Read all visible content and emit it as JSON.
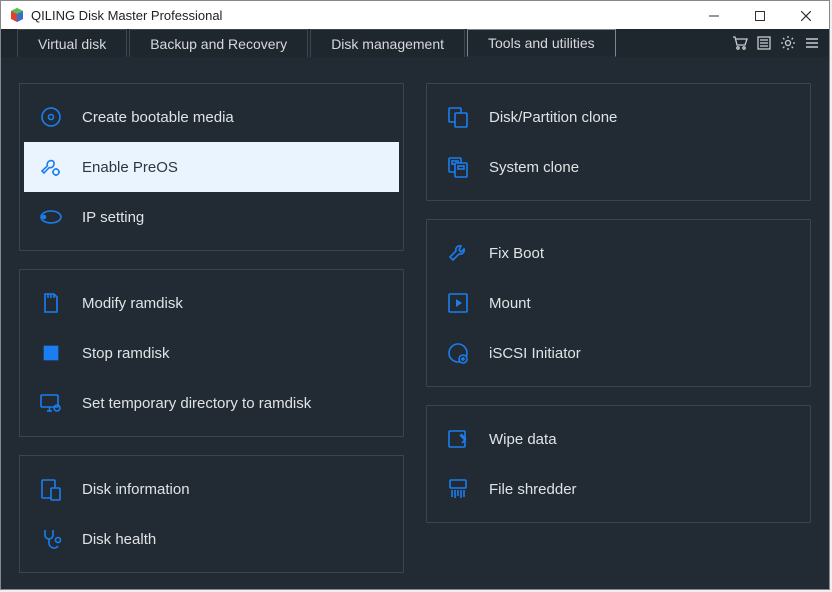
{
  "titlebar": {
    "title": "QILING Disk Master Professional"
  },
  "tabs": {
    "t0": "Virtual disk",
    "t1": "Backup and Recovery",
    "t2": "Disk management",
    "t3": "Tools and utilities"
  },
  "left": {
    "g1": {
      "i0": "Create bootable media",
      "i1": "Enable PreOS",
      "i2": "IP setting"
    },
    "g2": {
      "i0": "Modify ramdisk",
      "i1": "Stop ramdisk",
      "i2": "Set temporary directory to ramdisk"
    },
    "g3": {
      "i0": "Disk information",
      "i1": "Disk health"
    }
  },
  "right": {
    "g1": {
      "i0": "Disk/Partition clone",
      "i1": "System clone"
    },
    "g2": {
      "i0": "Fix Boot",
      "i1": "Mount",
      "i2": "iSCSI Initiator"
    },
    "g3": {
      "i0": "Wipe data",
      "i1": "File shredder"
    }
  }
}
